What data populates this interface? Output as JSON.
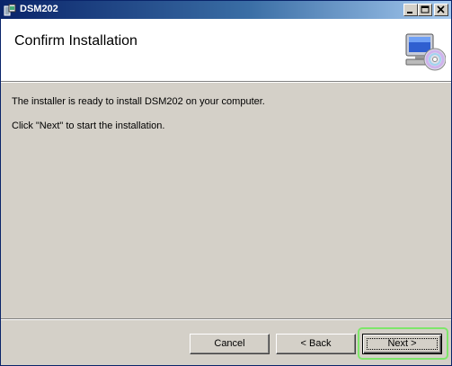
{
  "window": {
    "title": "DSM202"
  },
  "header": {
    "title": "Confirm Installation",
    "icon": "computer-cd-icon"
  },
  "body": {
    "line1": "The installer is ready to install DSM202 on your computer.",
    "line2": "Click \"Next\" to start the installation."
  },
  "buttons": {
    "cancel": "Cancel",
    "back": "< Back",
    "next": "Next >"
  },
  "colors": {
    "titlebar_start": "#0a246a",
    "titlebar_end": "#a6caf0",
    "dialog_bg": "#d4d0c8",
    "next_highlight": "#7ee66a"
  }
}
